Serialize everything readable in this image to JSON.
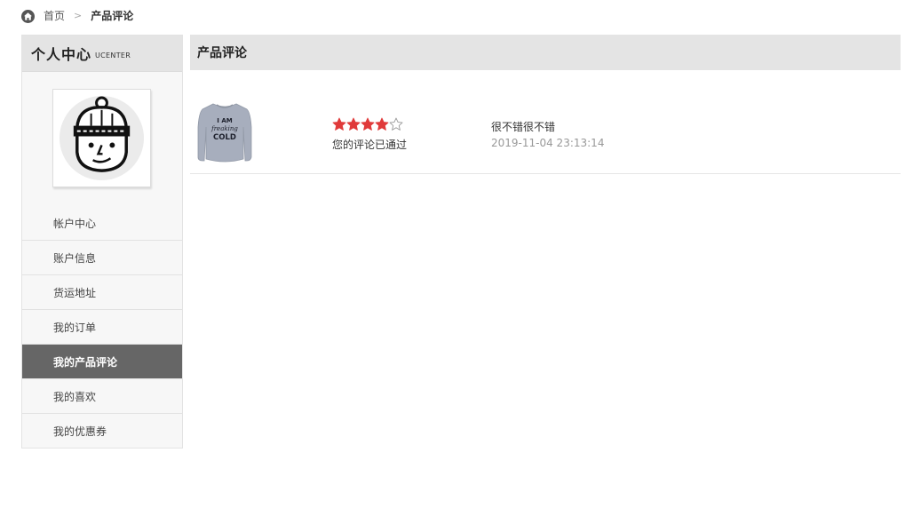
{
  "breadcrumb": {
    "home": "首页",
    "separator": ">",
    "current": "产品评论"
  },
  "sidebar": {
    "title": "个人中心",
    "subtitle": "UCENTER",
    "items": [
      {
        "label": "帐户中心",
        "active": false
      },
      {
        "label": "账户信息",
        "active": false
      },
      {
        "label": "货运地址",
        "active": false
      },
      {
        "label": "我的订单",
        "active": false
      },
      {
        "label": "我的产品评论",
        "active": true
      },
      {
        "label": "我的喜欢",
        "active": false
      },
      {
        "label": "我的优惠券",
        "active": false
      }
    ]
  },
  "main": {
    "title": "产品评论",
    "reviews": [
      {
        "product_text": [
          "I AM",
          "freaking",
          "COLD"
        ],
        "rating": 4,
        "rating_max": 5,
        "status": "您的评论已通过",
        "content": "很不错很不错",
        "time": "2019-11-04 23:13:14"
      }
    ]
  },
  "colors": {
    "star": "#e03a3a",
    "active_menu_bg": "#666666",
    "header_bg": "#e4e4e4"
  }
}
